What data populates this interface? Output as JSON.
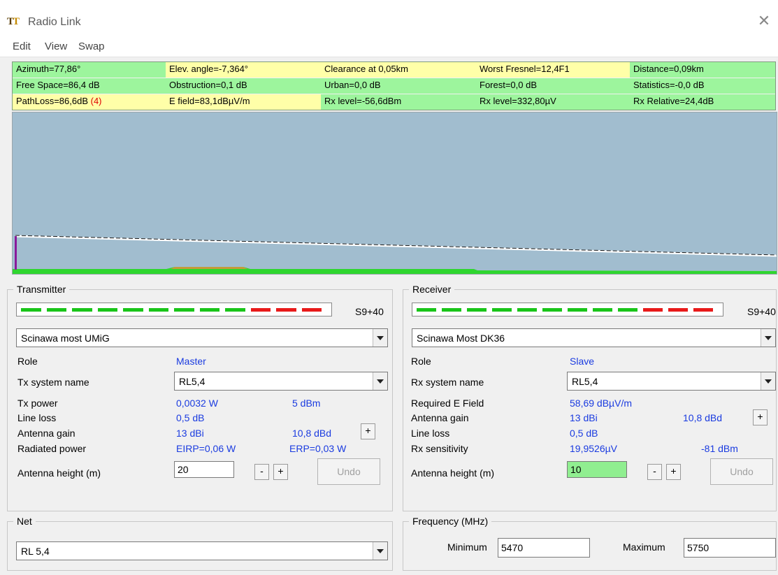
{
  "window": {
    "title": "Radio Link",
    "app_icon_letters": [
      "T",
      "T"
    ]
  },
  "menu": [
    "Edit",
    "View",
    "Swap"
  ],
  "info": {
    "rows": [
      [
        "Azimuth=77,86°",
        "Elev. angle=-7,364°",
        "Clearance at 0,05km",
        "Worst Fresnel=12,4F1",
        "Distance=0,09km"
      ],
      [
        "Free Space=86,4 dB",
        "Obstruction=0,1 dB",
        "Urban=0,0 dB",
        "Forest=0,0 dB",
        "Statistics=-0,0 dB"
      ],
      [
        "PathLoss=86,6dB",
        "E field=83,1dBµV/m",
        "Rx level=-56,6dBm",
        "Rx level=332,80µV",
        "Rx Relative=24,4dB"
      ]
    ],
    "pathloss_suffix": "(4)",
    "colors": {
      "yellow": "#ffffa8",
      "green": "#9df59d",
      "red_text": "#e00000"
    }
  },
  "transmitter": {
    "legend": "Transmitter",
    "meter_label": "S9+40",
    "meter_green_segments": 9,
    "meter_red_segments": 3,
    "site": "Scinawa most UMiG",
    "role_label": "Role",
    "role_value": "Master",
    "system_label": "Tx system name",
    "system_value": "RL5,4",
    "power_label": "Tx power",
    "power_w": "0,0032 W",
    "power_dbm": "5 dBm",
    "lineloss_label": "Line loss",
    "lineloss_value": "0,5 dB",
    "gain_label": "Antenna gain",
    "gain_dbi": "13 dBi",
    "gain_dbd": "10,8 dBd",
    "radiated_label": "Radiated power",
    "eirp": "EIRP=0,06 W",
    "erp": "ERP=0,03 W",
    "height_label": "Antenna height (m)",
    "height_value": "20",
    "minus": "-",
    "plus": "+",
    "undo": "Undo"
  },
  "receiver": {
    "legend": "Receiver",
    "meter_label": "S9+40",
    "meter_green_segments": 9,
    "meter_red_segments": 3,
    "site": "Scinawa Most DK36",
    "role_label": "Role",
    "role_value": "Slave",
    "system_label": "Rx system name",
    "system_value": "RL5,4",
    "req_label": "Required E Field",
    "req_value": "58,69 dBµV/m",
    "gain_label": "Antenna gain",
    "gain_dbi": "13 dBi",
    "gain_dbd": "10,8 dBd",
    "lineloss_label": "Line loss",
    "lineloss_value": "0,5 dB",
    "sens_label": "Rx sensitivity",
    "sens_uv": "19,9526µV",
    "sens_dbm": "-81 dBm",
    "height_label": "Antenna height (m)",
    "height_value": "10",
    "minus": "-",
    "plus": "+",
    "undo": "Undo"
  },
  "net": {
    "legend": "Net",
    "value": "RL 5,4"
  },
  "frequency": {
    "legend": "Frequency (MHz)",
    "min_label": "Minimum",
    "min_value": "5470",
    "max_label": "Maximum",
    "max_value": "5750"
  },
  "colors": {
    "profile_bg": "#a1bdcf",
    "terrain": "#2fd62f",
    "meter_green": "#19c519",
    "meter_red": "#e81a1a",
    "value_blue": "#1a3be0",
    "highlight_green": "#90ee90"
  }
}
